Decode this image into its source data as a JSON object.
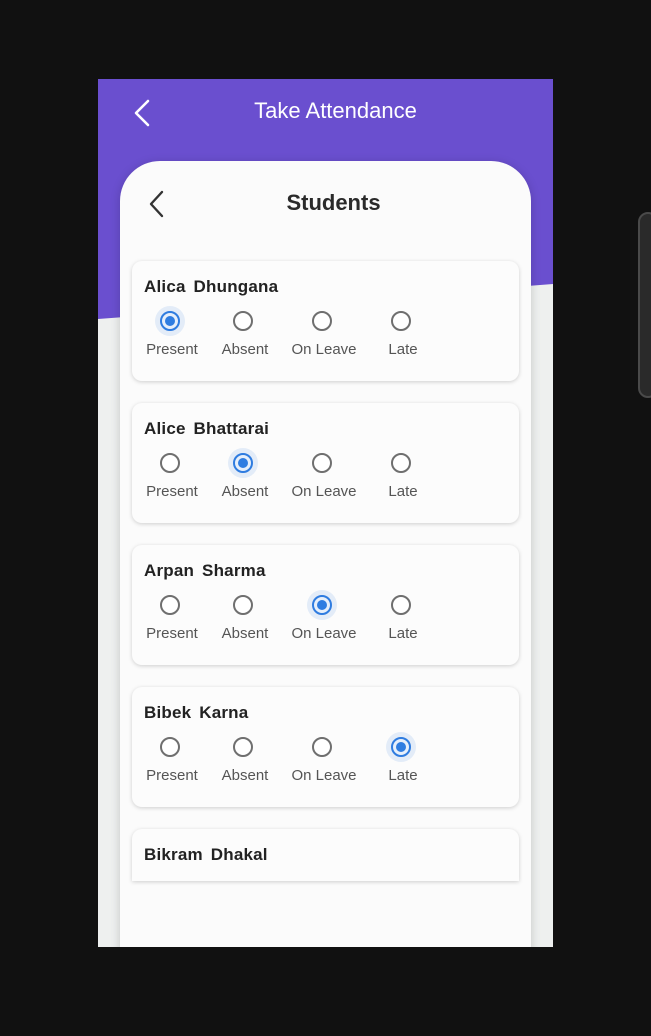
{
  "app": {
    "title": "Take Attendance",
    "accent_color": "#6a4fcf"
  },
  "card": {
    "title": "Students"
  },
  "option_labels": {
    "present": "Present",
    "absent": "Absent",
    "on_leave": "On Leave",
    "late": "Late"
  },
  "students": [
    {
      "name": "Alica  Dhungana",
      "status": "Present"
    },
    {
      "name": "Alice  Bhattarai",
      "status": "Absent"
    },
    {
      "name": "Arpan  Sharma",
      "status": "On Leave"
    },
    {
      "name": "Bibek  Karna",
      "status": "Late"
    },
    {
      "name": "Bikram  Dhakal",
      "status": ""
    }
  ],
  "save_button": {
    "icon": "save-icon",
    "color": "#ef4f4f"
  },
  "selected_color": "#2f7de1"
}
